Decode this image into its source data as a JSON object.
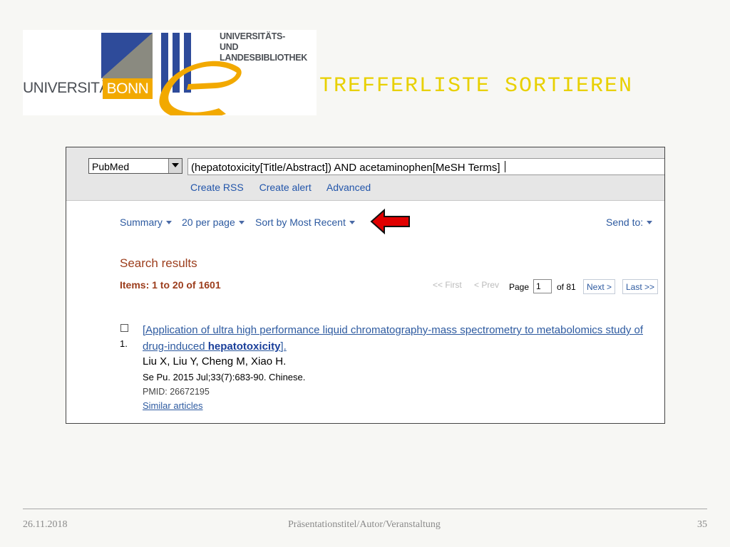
{
  "logo": {
    "university_text": "UNIVERSITÄT",
    "bonn_text": "BONN",
    "ulb_line1": "UNIVERSITÄTS-",
    "ulb_line2": "UND LANDESBIBLIOTHEK",
    "colors": {
      "blue": "#2e4b9a",
      "gray": "#8a8a80",
      "orange": "#f2a900"
    }
  },
  "slide_title": "TREFFERLISTE SORTIEREN",
  "screenshot": {
    "database": "PubMed",
    "query": "(hepatotoxicity[Title/Abstract]) AND acetaminophen[MeSH Terms]",
    "links": [
      "Create RSS",
      "Create alert",
      "Advanced"
    ],
    "controls": {
      "summary": "Summary",
      "per_page": "20 per page",
      "sort": "Sort by Most Recent",
      "send_to": "Send to:"
    },
    "results_heading": "Search results",
    "items_count": "Items: 1 to 20 of 1601",
    "pager": {
      "first": "<< First",
      "prev": "< Prev",
      "page_label": "Page",
      "page_value": "1",
      "of": "of 81",
      "next": "Next >",
      "last": "Last >>"
    },
    "result": {
      "number": "1.",
      "title_part1": "[Application of ultra high performance liquid chromatography-mass spectrometry to metabolomics study of drug-induced ",
      "title_bold": "hepatotoxicity",
      "title_part2": "].",
      "authors": "Liu X, Liu Y, Cheng M, Xiao H.",
      "journal": "Se Pu. 2015 Jul;33(7):683-90. Chinese.",
      "pmid": "PMID: 26672195",
      "similar": "Similar articles"
    },
    "arrow_color": "#e00000"
  },
  "footer": {
    "date": "26.11.2018",
    "center": "Präsentationstitel/Autor/Veranstaltung",
    "page": "35"
  }
}
